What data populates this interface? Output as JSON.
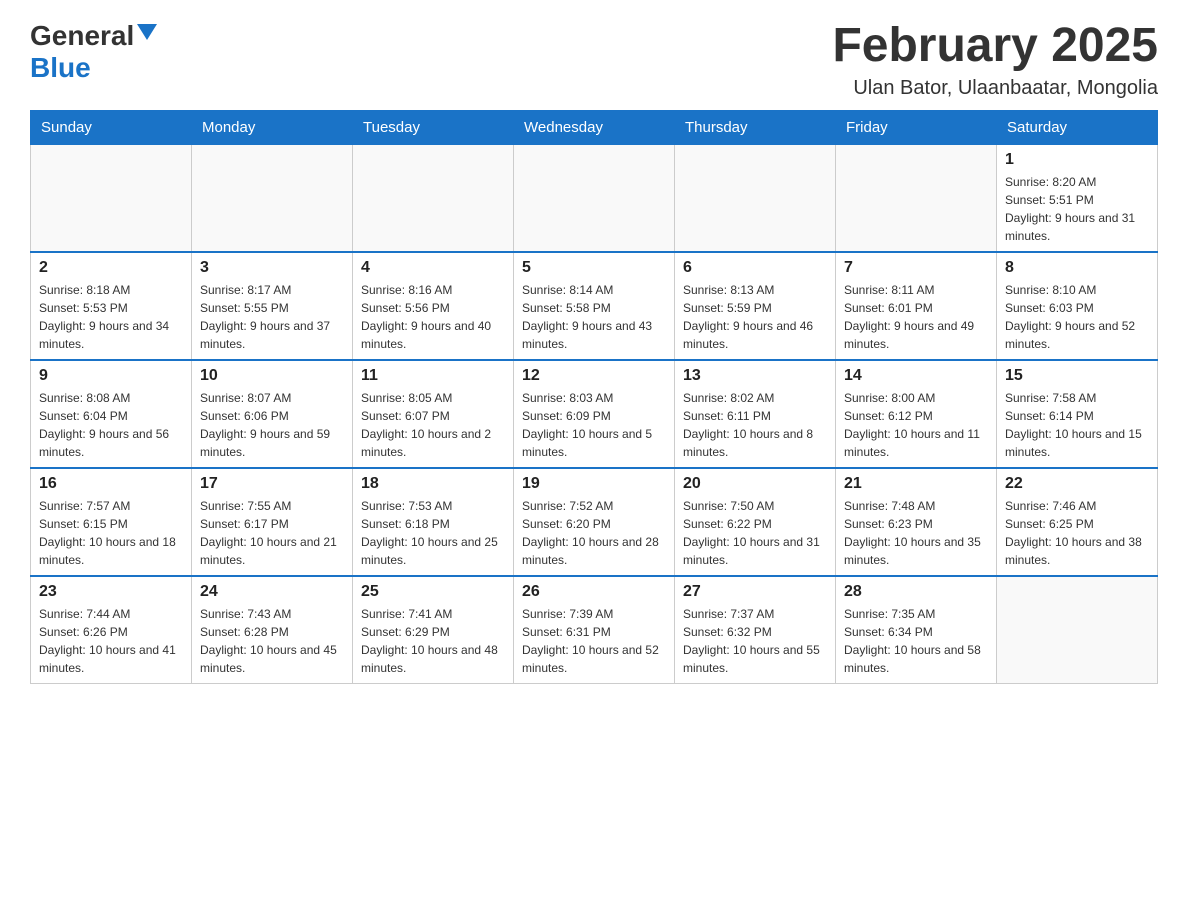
{
  "header": {
    "logo_general": "General",
    "logo_blue": "Blue",
    "title": "February 2025",
    "subtitle": "Ulan Bator, Ulaanbaatar, Mongolia"
  },
  "days_of_week": [
    "Sunday",
    "Monday",
    "Tuesday",
    "Wednesday",
    "Thursday",
    "Friday",
    "Saturday"
  ],
  "weeks": [
    [
      {
        "day": "",
        "info": ""
      },
      {
        "day": "",
        "info": ""
      },
      {
        "day": "",
        "info": ""
      },
      {
        "day": "",
        "info": ""
      },
      {
        "day": "",
        "info": ""
      },
      {
        "day": "",
        "info": ""
      },
      {
        "day": "1",
        "info": "Sunrise: 8:20 AM\nSunset: 5:51 PM\nDaylight: 9 hours and 31 minutes."
      }
    ],
    [
      {
        "day": "2",
        "info": "Sunrise: 8:18 AM\nSunset: 5:53 PM\nDaylight: 9 hours and 34 minutes."
      },
      {
        "day": "3",
        "info": "Sunrise: 8:17 AM\nSunset: 5:55 PM\nDaylight: 9 hours and 37 minutes."
      },
      {
        "day": "4",
        "info": "Sunrise: 8:16 AM\nSunset: 5:56 PM\nDaylight: 9 hours and 40 minutes."
      },
      {
        "day": "5",
        "info": "Sunrise: 8:14 AM\nSunset: 5:58 PM\nDaylight: 9 hours and 43 minutes."
      },
      {
        "day": "6",
        "info": "Sunrise: 8:13 AM\nSunset: 5:59 PM\nDaylight: 9 hours and 46 minutes."
      },
      {
        "day": "7",
        "info": "Sunrise: 8:11 AM\nSunset: 6:01 PM\nDaylight: 9 hours and 49 minutes."
      },
      {
        "day": "8",
        "info": "Sunrise: 8:10 AM\nSunset: 6:03 PM\nDaylight: 9 hours and 52 minutes."
      }
    ],
    [
      {
        "day": "9",
        "info": "Sunrise: 8:08 AM\nSunset: 6:04 PM\nDaylight: 9 hours and 56 minutes."
      },
      {
        "day": "10",
        "info": "Sunrise: 8:07 AM\nSunset: 6:06 PM\nDaylight: 9 hours and 59 minutes."
      },
      {
        "day": "11",
        "info": "Sunrise: 8:05 AM\nSunset: 6:07 PM\nDaylight: 10 hours and 2 minutes."
      },
      {
        "day": "12",
        "info": "Sunrise: 8:03 AM\nSunset: 6:09 PM\nDaylight: 10 hours and 5 minutes."
      },
      {
        "day": "13",
        "info": "Sunrise: 8:02 AM\nSunset: 6:11 PM\nDaylight: 10 hours and 8 minutes."
      },
      {
        "day": "14",
        "info": "Sunrise: 8:00 AM\nSunset: 6:12 PM\nDaylight: 10 hours and 11 minutes."
      },
      {
        "day": "15",
        "info": "Sunrise: 7:58 AM\nSunset: 6:14 PM\nDaylight: 10 hours and 15 minutes."
      }
    ],
    [
      {
        "day": "16",
        "info": "Sunrise: 7:57 AM\nSunset: 6:15 PM\nDaylight: 10 hours and 18 minutes."
      },
      {
        "day": "17",
        "info": "Sunrise: 7:55 AM\nSunset: 6:17 PM\nDaylight: 10 hours and 21 minutes."
      },
      {
        "day": "18",
        "info": "Sunrise: 7:53 AM\nSunset: 6:18 PM\nDaylight: 10 hours and 25 minutes."
      },
      {
        "day": "19",
        "info": "Sunrise: 7:52 AM\nSunset: 6:20 PM\nDaylight: 10 hours and 28 minutes."
      },
      {
        "day": "20",
        "info": "Sunrise: 7:50 AM\nSunset: 6:22 PM\nDaylight: 10 hours and 31 minutes."
      },
      {
        "day": "21",
        "info": "Sunrise: 7:48 AM\nSunset: 6:23 PM\nDaylight: 10 hours and 35 minutes."
      },
      {
        "day": "22",
        "info": "Sunrise: 7:46 AM\nSunset: 6:25 PM\nDaylight: 10 hours and 38 minutes."
      }
    ],
    [
      {
        "day": "23",
        "info": "Sunrise: 7:44 AM\nSunset: 6:26 PM\nDaylight: 10 hours and 41 minutes."
      },
      {
        "day": "24",
        "info": "Sunrise: 7:43 AM\nSunset: 6:28 PM\nDaylight: 10 hours and 45 minutes."
      },
      {
        "day": "25",
        "info": "Sunrise: 7:41 AM\nSunset: 6:29 PM\nDaylight: 10 hours and 48 minutes."
      },
      {
        "day": "26",
        "info": "Sunrise: 7:39 AM\nSunset: 6:31 PM\nDaylight: 10 hours and 52 minutes."
      },
      {
        "day": "27",
        "info": "Sunrise: 7:37 AM\nSunset: 6:32 PM\nDaylight: 10 hours and 55 minutes."
      },
      {
        "day": "28",
        "info": "Sunrise: 7:35 AM\nSunset: 6:34 PM\nDaylight: 10 hours and 58 minutes."
      },
      {
        "day": "",
        "info": ""
      }
    ]
  ]
}
